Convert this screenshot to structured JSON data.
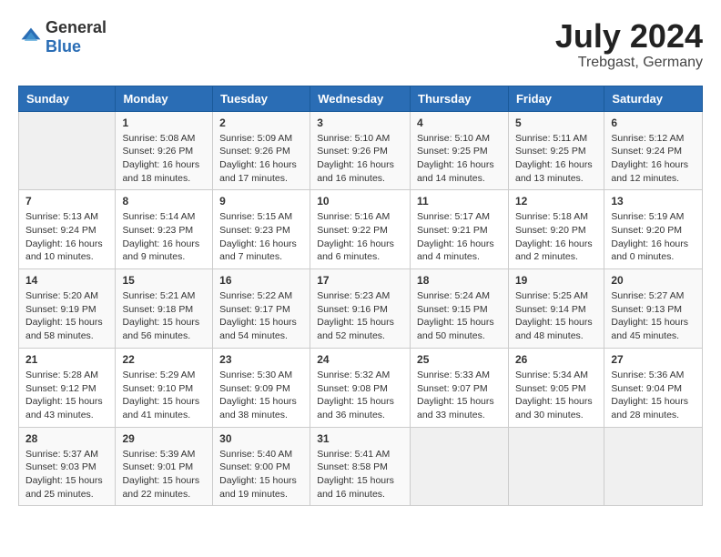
{
  "header": {
    "logo_general": "General",
    "logo_blue": "Blue",
    "month_year": "July 2024",
    "location": "Trebgast, Germany"
  },
  "days_of_week": [
    "Sunday",
    "Monday",
    "Tuesday",
    "Wednesday",
    "Thursday",
    "Friday",
    "Saturday"
  ],
  "weeks": [
    [
      {
        "day": "",
        "sunrise": "",
        "sunset": "",
        "daylight": "",
        "empty": true
      },
      {
        "day": "1",
        "sunrise": "Sunrise: 5:08 AM",
        "sunset": "Sunset: 9:26 PM",
        "daylight": "Daylight: 16 hours and 18 minutes."
      },
      {
        "day": "2",
        "sunrise": "Sunrise: 5:09 AM",
        "sunset": "Sunset: 9:26 PM",
        "daylight": "Daylight: 16 hours and 17 minutes."
      },
      {
        "day": "3",
        "sunrise": "Sunrise: 5:10 AM",
        "sunset": "Sunset: 9:26 PM",
        "daylight": "Daylight: 16 hours and 16 minutes."
      },
      {
        "day": "4",
        "sunrise": "Sunrise: 5:10 AM",
        "sunset": "Sunset: 9:25 PM",
        "daylight": "Daylight: 16 hours and 14 minutes."
      },
      {
        "day": "5",
        "sunrise": "Sunrise: 5:11 AM",
        "sunset": "Sunset: 9:25 PM",
        "daylight": "Daylight: 16 hours and 13 minutes."
      },
      {
        "day": "6",
        "sunrise": "Sunrise: 5:12 AM",
        "sunset": "Sunset: 9:24 PM",
        "daylight": "Daylight: 16 hours and 12 minutes."
      }
    ],
    [
      {
        "day": "7",
        "sunrise": "Sunrise: 5:13 AM",
        "sunset": "Sunset: 9:24 PM",
        "daylight": "Daylight: 16 hours and 10 minutes."
      },
      {
        "day": "8",
        "sunrise": "Sunrise: 5:14 AM",
        "sunset": "Sunset: 9:23 PM",
        "daylight": "Daylight: 16 hours and 9 minutes."
      },
      {
        "day": "9",
        "sunrise": "Sunrise: 5:15 AM",
        "sunset": "Sunset: 9:23 PM",
        "daylight": "Daylight: 16 hours and 7 minutes."
      },
      {
        "day": "10",
        "sunrise": "Sunrise: 5:16 AM",
        "sunset": "Sunset: 9:22 PM",
        "daylight": "Daylight: 16 hours and 6 minutes."
      },
      {
        "day": "11",
        "sunrise": "Sunrise: 5:17 AM",
        "sunset": "Sunset: 9:21 PM",
        "daylight": "Daylight: 16 hours and 4 minutes."
      },
      {
        "day": "12",
        "sunrise": "Sunrise: 5:18 AM",
        "sunset": "Sunset: 9:20 PM",
        "daylight": "Daylight: 16 hours and 2 minutes."
      },
      {
        "day": "13",
        "sunrise": "Sunrise: 5:19 AM",
        "sunset": "Sunset: 9:20 PM",
        "daylight": "Daylight: 16 hours and 0 minutes."
      }
    ],
    [
      {
        "day": "14",
        "sunrise": "Sunrise: 5:20 AM",
        "sunset": "Sunset: 9:19 PM",
        "daylight": "Daylight: 15 hours and 58 minutes."
      },
      {
        "day": "15",
        "sunrise": "Sunrise: 5:21 AM",
        "sunset": "Sunset: 9:18 PM",
        "daylight": "Daylight: 15 hours and 56 minutes."
      },
      {
        "day": "16",
        "sunrise": "Sunrise: 5:22 AM",
        "sunset": "Sunset: 9:17 PM",
        "daylight": "Daylight: 15 hours and 54 minutes."
      },
      {
        "day": "17",
        "sunrise": "Sunrise: 5:23 AM",
        "sunset": "Sunset: 9:16 PM",
        "daylight": "Daylight: 15 hours and 52 minutes."
      },
      {
        "day": "18",
        "sunrise": "Sunrise: 5:24 AM",
        "sunset": "Sunset: 9:15 PM",
        "daylight": "Daylight: 15 hours and 50 minutes."
      },
      {
        "day": "19",
        "sunrise": "Sunrise: 5:25 AM",
        "sunset": "Sunset: 9:14 PM",
        "daylight": "Daylight: 15 hours and 48 minutes."
      },
      {
        "day": "20",
        "sunrise": "Sunrise: 5:27 AM",
        "sunset": "Sunset: 9:13 PM",
        "daylight": "Daylight: 15 hours and 45 minutes."
      }
    ],
    [
      {
        "day": "21",
        "sunrise": "Sunrise: 5:28 AM",
        "sunset": "Sunset: 9:12 PM",
        "daylight": "Daylight: 15 hours and 43 minutes."
      },
      {
        "day": "22",
        "sunrise": "Sunrise: 5:29 AM",
        "sunset": "Sunset: 9:10 PM",
        "daylight": "Daylight: 15 hours and 41 minutes."
      },
      {
        "day": "23",
        "sunrise": "Sunrise: 5:30 AM",
        "sunset": "Sunset: 9:09 PM",
        "daylight": "Daylight: 15 hours and 38 minutes."
      },
      {
        "day": "24",
        "sunrise": "Sunrise: 5:32 AM",
        "sunset": "Sunset: 9:08 PM",
        "daylight": "Daylight: 15 hours and 36 minutes."
      },
      {
        "day": "25",
        "sunrise": "Sunrise: 5:33 AM",
        "sunset": "Sunset: 9:07 PM",
        "daylight": "Daylight: 15 hours and 33 minutes."
      },
      {
        "day": "26",
        "sunrise": "Sunrise: 5:34 AM",
        "sunset": "Sunset: 9:05 PM",
        "daylight": "Daylight: 15 hours and 30 minutes."
      },
      {
        "day": "27",
        "sunrise": "Sunrise: 5:36 AM",
        "sunset": "Sunset: 9:04 PM",
        "daylight": "Daylight: 15 hours and 28 minutes."
      }
    ],
    [
      {
        "day": "28",
        "sunrise": "Sunrise: 5:37 AM",
        "sunset": "Sunset: 9:03 PM",
        "daylight": "Daylight: 15 hours and 25 minutes."
      },
      {
        "day": "29",
        "sunrise": "Sunrise: 5:39 AM",
        "sunset": "Sunset: 9:01 PM",
        "daylight": "Daylight: 15 hours and 22 minutes."
      },
      {
        "day": "30",
        "sunrise": "Sunrise: 5:40 AM",
        "sunset": "Sunset: 9:00 PM",
        "daylight": "Daylight: 15 hours and 19 minutes."
      },
      {
        "day": "31",
        "sunrise": "Sunrise: 5:41 AM",
        "sunset": "Sunset: 8:58 PM",
        "daylight": "Daylight: 15 hours and 16 minutes."
      },
      {
        "day": "",
        "sunrise": "",
        "sunset": "",
        "daylight": "",
        "empty": true
      },
      {
        "day": "",
        "sunrise": "",
        "sunset": "",
        "daylight": "",
        "empty": true
      },
      {
        "day": "",
        "sunrise": "",
        "sunset": "",
        "daylight": "",
        "empty": true
      }
    ]
  ]
}
